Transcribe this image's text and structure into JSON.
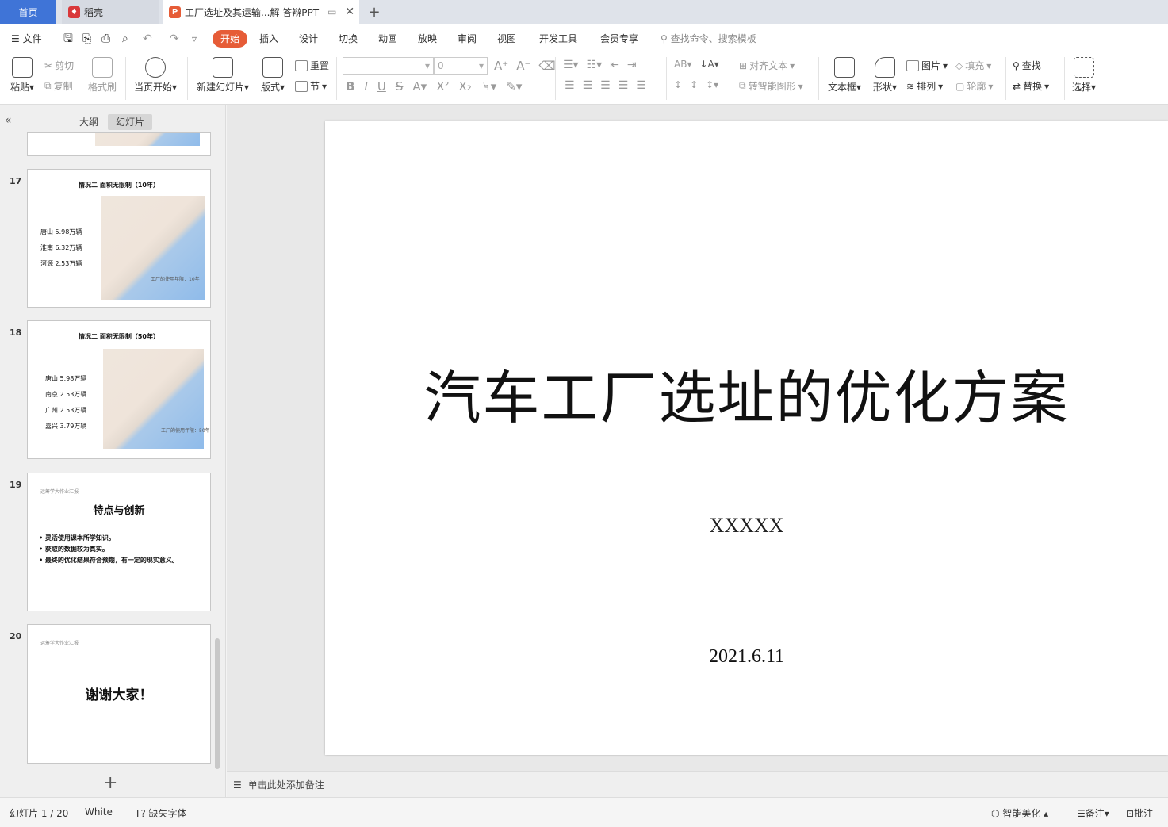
{
  "tabs": {
    "home": "首页",
    "daoke": "稻壳",
    "doc": "工厂选址及其运输...解  答辩PPT"
  },
  "menu": {
    "file": "文件",
    "start": "开始",
    "insert": "插入",
    "design": "设计",
    "transition": "切换",
    "animation": "动画",
    "slideshow": "放映",
    "review": "审阅",
    "view": "视图",
    "devtools": "开发工具",
    "member": "会员专享",
    "search_placeholder": "查找命令、搜索模板"
  },
  "ribbon": {
    "paste": "粘贴",
    "cut": "剪切",
    "copy": "复制",
    "format_painter": "格式刷",
    "from_current": "当页开始",
    "new_slide": "新建幻灯片",
    "layout": "版式",
    "reset": "重置",
    "section": "节",
    "font_size": "0",
    "align_text": "对齐文本",
    "to_smartart": "转智能图形",
    "textbox": "文本框",
    "shape": "形状",
    "picture": "图片",
    "arrange": "排列",
    "fill": "填充",
    "outline": "轮廓",
    "find": "查找",
    "replace": "替换",
    "select": "选择"
  },
  "panel": {
    "outline_tab": "大纲",
    "slides_tab": "幻灯片"
  },
  "thumbnails": [
    {
      "num": "17",
      "title": "情况二 面积无限制（10年）",
      "lines": [
        "唐山 5.98万辆",
        "淮南 6.32万辆",
        "河源 2.53万辆"
      ],
      "caption": "工厂的使用年限：10年"
    },
    {
      "num": "18",
      "title": "情况二 面积无限制（50年）",
      "lines": [
        "唐山 5.98万辆",
        "南京 2.53万辆",
        "广州 2.53万辆",
        "嘉兴 3.79万辆"
      ],
      "caption": "工厂的使用年限：50年"
    },
    {
      "num": "19",
      "small": "运筹学大作业汇报",
      "title": "特点与创新",
      "lines": [
        "• 灵活使用课本所学知识。",
        "• 获取的数据较为真实。",
        "• 最终的优化结果符合预期，有一定的现实意义。"
      ]
    },
    {
      "num": "20",
      "small": "运筹学大作业汇报",
      "title": "谢谢大家！"
    }
  ],
  "slide": {
    "title": "汽车工厂选址的优化方案",
    "author": "XXXXX",
    "date": "2021.6.11"
  },
  "notes_placeholder": "单击此处添加备注",
  "status": {
    "slide_counter": "幻灯片 1 / 20",
    "theme": "White",
    "missing_font": "缺失字体",
    "beautify": "智能美化",
    "notes": "备注",
    "comments": "批注"
  },
  "colors": {
    "accent": "#e65c37",
    "home_tab": "#3f74d7"
  }
}
